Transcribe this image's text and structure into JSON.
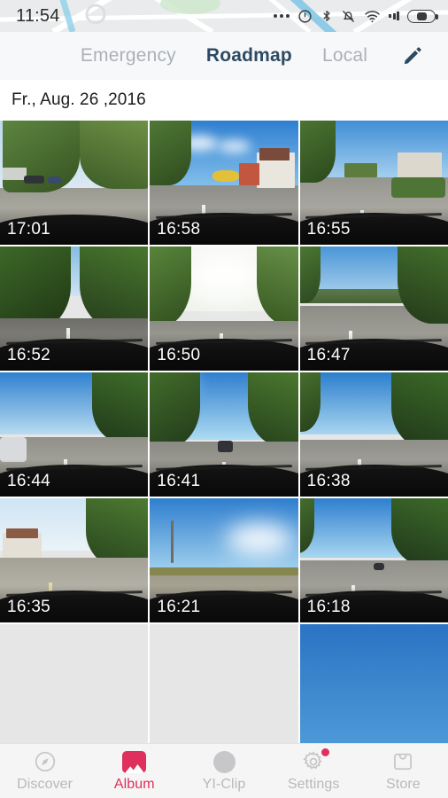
{
  "status_bar": {
    "time": "11:54",
    "icons": [
      "more-dots-icon",
      "headset-icon",
      "bluetooth-icon",
      "mute-bell-icon",
      "wifi-icon",
      "signal-icon",
      "battery-icon"
    ]
  },
  "header": {
    "tabs": [
      {
        "label": "Emergency",
        "active": false
      },
      {
        "label": "Roadmap",
        "active": true
      },
      {
        "label": "Local",
        "active": false
      }
    ],
    "edit_icon": "pencil-icon",
    "active_color": "#2c4a63",
    "inactive_color": "#adb1b5"
  },
  "date_header": {
    "text": "Fr., Aug. 26 ,2016"
  },
  "album": {
    "rows": [
      [
        {
          "time": "17:01",
          "scene": "suburban-road-trees"
        },
        {
          "time": "16:58",
          "scene": "village-street-houses"
        },
        {
          "time": "16:55",
          "scene": "residential-street"
        }
      ],
      [
        {
          "time": "16:52",
          "scene": "forest-road"
        },
        {
          "time": "16:50",
          "scene": "bright-forest-road"
        },
        {
          "time": "16:47",
          "scene": "highway-hills"
        }
      ],
      [
        {
          "time": "16:44",
          "scene": "highway-guardrail"
        },
        {
          "time": "16:41",
          "scene": "highway-sun-flare"
        },
        {
          "time": "16:38",
          "scene": "highway-trees"
        }
      ],
      [
        {
          "time": "16:35",
          "scene": "village-driveway"
        },
        {
          "time": "16:21",
          "scene": "country-road-field"
        },
        {
          "time": "16:18",
          "scene": "autobahn-curve"
        }
      ],
      [
        {
          "time": "",
          "scene": "placeholder"
        },
        {
          "time": "",
          "scene": "placeholder"
        },
        {
          "time": "",
          "scene": "blue-sky"
        }
      ]
    ]
  },
  "bottom_nav": {
    "items": [
      {
        "label": "Discover",
        "icon": "compass-icon",
        "active": false,
        "badge": false
      },
      {
        "label": "Album",
        "icon": "photo-icon",
        "active": true,
        "badge": false
      },
      {
        "label": "YI-Clip",
        "icon": "circle-icon",
        "active": false,
        "badge": false
      },
      {
        "label": "Settings",
        "icon": "gear-icon",
        "active": false,
        "badge": true
      },
      {
        "label": "Store",
        "icon": "shopping-bag-icon",
        "active": false,
        "badge": false
      }
    ],
    "active_color": "#df2f5c",
    "inactive_color": "#b9b9bb"
  }
}
